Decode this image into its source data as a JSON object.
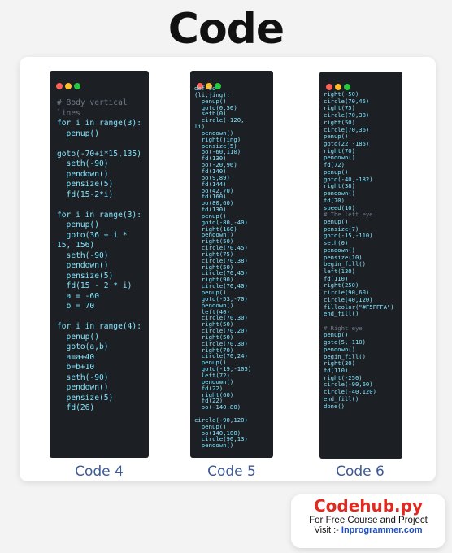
{
  "title": "Code",
  "panels": [
    {
      "caption": "Code 4",
      "lines": [
        "# Body vertical",
        "lines",
        "for i in range(3):",
        "  penup()",
        "",
        "goto(-70+i*15,135)",
        "  seth(-90)",
        "  pendown()",
        "  pensize(5)",
        "  fd(15-2*i)",
        "",
        "for i in range(3):",
        "  penup()",
        "  goto(36 + i *",
        "15, 156)",
        "  seth(-90)",
        "  pendown()",
        "  pensize(5)",
        "  fd(15 - 2 * i)",
        "  a = -60",
        "  b = 70",
        "",
        "for i in range(4):",
        "  penup()",
        "  goto(a,b)",
        "  a=a+40",
        "  b=b+10",
        "  seth(-90)",
        "  pendown()",
        "  pensize(5)",
        "  fd(26)"
      ]
    },
    {
      "caption": "Code 5",
      "lines": [
        "def oo",
        "(li,jing):",
        "  penup()",
        "  goto(0,50)",
        "  seth(0)",
        "  circle(-120,",
        "li)",
        "  pendown()",
        "  right(jing)",
        "  pensize(5)",
        "  oo(-60,110)",
        "  fd(130)",
        "  oo(-20,96)",
        "  fd(140)",
        "  oo(9,89)",
        "  fd(144)",
        "  oo(42,70)",
        "  fd(160)",
        "  oo(80,60)",
        "  fd(130)",
        "  penup()",
        "  goto(-80,-40)",
        "  right(160)",
        "  pendown()",
        "  right(50)",
        "  circle(70,45)",
        "  right(75)",
        "  circle(70,38)",
        "  right(50)",
        "  circle(70,45)",
        "  right(90)",
        "  circle(70,40)",
        "  penup()",
        "  goto(-53,-70)",
        "  pendown()",
        "  left(40)",
        "  circle(70,30)",
        "  right(50)",
        "  circle(70,20)",
        "  right(50)",
        "  circle(70,30)",
        "  right(70)",
        "  circle(70,24)",
        "  penup()",
        "  goto(-19,-105)",
        "  left(72)",
        "  pendown()",
        "  fd(22)",
        "  right(60)",
        "  fd(22)",
        "  oo(-140,80)",
        "",
        "circle(-90,120)",
        "  penup()",
        "  oo(140,100)",
        "  circle(90,13)",
        "  pendown()"
      ]
    },
    {
      "caption": "Code 6",
      "lines": [
        "right(-50)",
        "circle(70,45)",
        "right(75)",
        "circle(70,38)",
        "right(50)",
        "circle(70,36)",
        "penup()",
        "goto(22,-185)",
        "right(70)",
        "pendown()",
        "fd(72)",
        "penup()",
        "goto(-40,-182)",
        "right(38)",
        "pendown()",
        "fd(70)",
        "speed(10)",
        "# The left eye",
        "penup()",
        "pensize(7)",
        "goto(-15,-110)",
        "seth(0)",
        "pendown()",
        "pensize(10)",
        "begin_fill()",
        "left(130)",
        "fd(110)",
        "right(250)",
        "circle(90,60)",
        "circle(40,120)",
        "fillcolor(\"#F5FFFA\")",
        "end_fill()",
        "",
        "# Right eye",
        "penup()",
        "goto(5,-110)",
        "pendown()",
        "begin_fill()",
        "right(30)",
        "fd(110)",
        "right(-250)",
        "circle(-90,60)",
        "circle(-40,120)",
        "end_fill()",
        "done()"
      ]
    }
  ],
  "promo": {
    "brand": "Codehub.py",
    "tagline": "For Free Course and Project",
    "visit_label": "Visit :-",
    "url": "Inprogrammer.com"
  },
  "colors": {
    "code_text": "#7fe6ff",
    "comment_text": "#6d7a87",
    "panel_bg": "#1c1f24",
    "caption": "#3d5a98",
    "brand": "#e12a1f",
    "url": "#1b4fd1"
  }
}
